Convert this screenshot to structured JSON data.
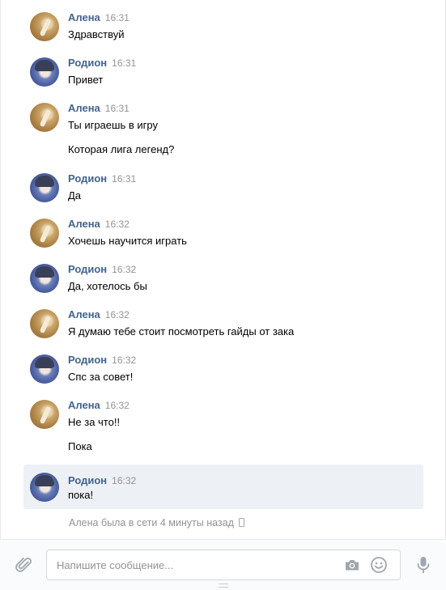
{
  "messages": [
    {
      "author": "Алена",
      "time": "16:31",
      "avatar": "alena",
      "lines": [
        "Здравствуй"
      ]
    },
    {
      "author": "Родион",
      "time": "16:31",
      "avatar": "rodion",
      "lines": [
        "Привет"
      ]
    },
    {
      "author": "Алена",
      "time": "16:31",
      "avatar": "alena",
      "lines": [
        "Ты играешь в игру",
        "Которая лига легенд?"
      ]
    },
    {
      "author": "Родион",
      "time": "16:31",
      "avatar": "rodion",
      "lines": [
        "Да"
      ]
    },
    {
      "author": "Алена",
      "time": "16:32",
      "avatar": "alena",
      "lines": [
        "Хочешь научится играть"
      ]
    },
    {
      "author": "Родион",
      "time": "16:32",
      "avatar": "rodion",
      "lines": [
        "Да, хотелось бы"
      ]
    },
    {
      "author": "Алена",
      "time": "16:32",
      "avatar": "alena",
      "lines": [
        "Я думаю тебе стоит посмотреть гайды от зака"
      ]
    },
    {
      "author": "Родион",
      "time": "16:32",
      "avatar": "rodion",
      "lines": [
        "Спс за совет!"
      ]
    },
    {
      "author": "Алена",
      "time": "16:32",
      "avatar": "alena",
      "lines": [
        "Не за что!!",
        "Пока"
      ]
    },
    {
      "author": "Родион",
      "time": "16:32",
      "avatar": "rodion",
      "lines": [
        "пока!"
      ],
      "highlighted": true
    }
  ],
  "status": {
    "text": "Алена была в сети 4 минуты назад",
    "icon": "phone-icon"
  },
  "composer": {
    "placeholder": "Напишите сообщение...",
    "value": "",
    "icons": {
      "attach": "paperclip-icon",
      "camera": "camera-icon",
      "emoji": "smile-icon",
      "voice": "microphone-icon"
    }
  },
  "colors": {
    "author": "#42648b",
    "time": "#939393",
    "highlight": "#edf0f5",
    "icon": "#a0a6ad"
  }
}
